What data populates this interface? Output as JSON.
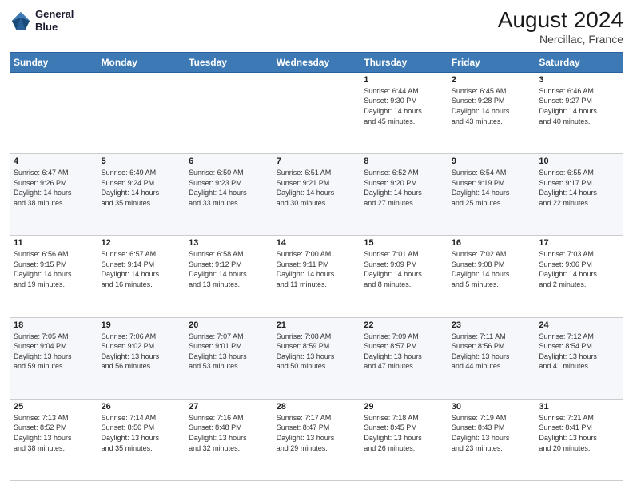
{
  "header": {
    "logo_line1": "General",
    "logo_line2": "Blue",
    "title": "August 2024",
    "subtitle": "Nercillac, France"
  },
  "weekdays": [
    "Sunday",
    "Monday",
    "Tuesday",
    "Wednesday",
    "Thursday",
    "Friday",
    "Saturday"
  ],
  "weeks": [
    [
      {
        "day": "",
        "detail": ""
      },
      {
        "day": "",
        "detail": ""
      },
      {
        "day": "",
        "detail": ""
      },
      {
        "day": "",
        "detail": ""
      },
      {
        "day": "1",
        "detail": "Sunrise: 6:44 AM\nSunset: 9:30 PM\nDaylight: 14 hours\nand 45 minutes."
      },
      {
        "day": "2",
        "detail": "Sunrise: 6:45 AM\nSunset: 9:28 PM\nDaylight: 14 hours\nand 43 minutes."
      },
      {
        "day": "3",
        "detail": "Sunrise: 6:46 AM\nSunset: 9:27 PM\nDaylight: 14 hours\nand 40 minutes."
      }
    ],
    [
      {
        "day": "4",
        "detail": "Sunrise: 6:47 AM\nSunset: 9:26 PM\nDaylight: 14 hours\nand 38 minutes."
      },
      {
        "day": "5",
        "detail": "Sunrise: 6:49 AM\nSunset: 9:24 PM\nDaylight: 14 hours\nand 35 minutes."
      },
      {
        "day": "6",
        "detail": "Sunrise: 6:50 AM\nSunset: 9:23 PM\nDaylight: 14 hours\nand 33 minutes."
      },
      {
        "day": "7",
        "detail": "Sunrise: 6:51 AM\nSunset: 9:21 PM\nDaylight: 14 hours\nand 30 minutes."
      },
      {
        "day": "8",
        "detail": "Sunrise: 6:52 AM\nSunset: 9:20 PM\nDaylight: 14 hours\nand 27 minutes."
      },
      {
        "day": "9",
        "detail": "Sunrise: 6:54 AM\nSunset: 9:19 PM\nDaylight: 14 hours\nand 25 minutes."
      },
      {
        "day": "10",
        "detail": "Sunrise: 6:55 AM\nSunset: 9:17 PM\nDaylight: 14 hours\nand 22 minutes."
      }
    ],
    [
      {
        "day": "11",
        "detail": "Sunrise: 6:56 AM\nSunset: 9:15 PM\nDaylight: 14 hours\nand 19 minutes."
      },
      {
        "day": "12",
        "detail": "Sunrise: 6:57 AM\nSunset: 9:14 PM\nDaylight: 14 hours\nand 16 minutes."
      },
      {
        "day": "13",
        "detail": "Sunrise: 6:58 AM\nSunset: 9:12 PM\nDaylight: 14 hours\nand 13 minutes."
      },
      {
        "day": "14",
        "detail": "Sunrise: 7:00 AM\nSunset: 9:11 PM\nDaylight: 14 hours\nand 11 minutes."
      },
      {
        "day": "15",
        "detail": "Sunrise: 7:01 AM\nSunset: 9:09 PM\nDaylight: 14 hours\nand 8 minutes."
      },
      {
        "day": "16",
        "detail": "Sunrise: 7:02 AM\nSunset: 9:08 PM\nDaylight: 14 hours\nand 5 minutes."
      },
      {
        "day": "17",
        "detail": "Sunrise: 7:03 AM\nSunset: 9:06 PM\nDaylight: 14 hours\nand 2 minutes."
      }
    ],
    [
      {
        "day": "18",
        "detail": "Sunrise: 7:05 AM\nSunset: 9:04 PM\nDaylight: 13 hours\nand 59 minutes."
      },
      {
        "day": "19",
        "detail": "Sunrise: 7:06 AM\nSunset: 9:02 PM\nDaylight: 13 hours\nand 56 minutes."
      },
      {
        "day": "20",
        "detail": "Sunrise: 7:07 AM\nSunset: 9:01 PM\nDaylight: 13 hours\nand 53 minutes."
      },
      {
        "day": "21",
        "detail": "Sunrise: 7:08 AM\nSunset: 8:59 PM\nDaylight: 13 hours\nand 50 minutes."
      },
      {
        "day": "22",
        "detail": "Sunrise: 7:09 AM\nSunset: 8:57 PM\nDaylight: 13 hours\nand 47 minutes."
      },
      {
        "day": "23",
        "detail": "Sunrise: 7:11 AM\nSunset: 8:56 PM\nDaylight: 13 hours\nand 44 minutes."
      },
      {
        "day": "24",
        "detail": "Sunrise: 7:12 AM\nSunset: 8:54 PM\nDaylight: 13 hours\nand 41 minutes."
      }
    ],
    [
      {
        "day": "25",
        "detail": "Sunrise: 7:13 AM\nSunset: 8:52 PM\nDaylight: 13 hours\nand 38 minutes."
      },
      {
        "day": "26",
        "detail": "Sunrise: 7:14 AM\nSunset: 8:50 PM\nDaylight: 13 hours\nand 35 minutes."
      },
      {
        "day": "27",
        "detail": "Sunrise: 7:16 AM\nSunset: 8:48 PM\nDaylight: 13 hours\nand 32 minutes."
      },
      {
        "day": "28",
        "detail": "Sunrise: 7:17 AM\nSunset: 8:47 PM\nDaylight: 13 hours\nand 29 minutes."
      },
      {
        "day": "29",
        "detail": "Sunrise: 7:18 AM\nSunset: 8:45 PM\nDaylight: 13 hours\nand 26 minutes."
      },
      {
        "day": "30",
        "detail": "Sunrise: 7:19 AM\nSunset: 8:43 PM\nDaylight: 13 hours\nand 23 minutes."
      },
      {
        "day": "31",
        "detail": "Sunrise: 7:21 AM\nSunset: 8:41 PM\nDaylight: 13 hours\nand 20 minutes."
      }
    ]
  ]
}
